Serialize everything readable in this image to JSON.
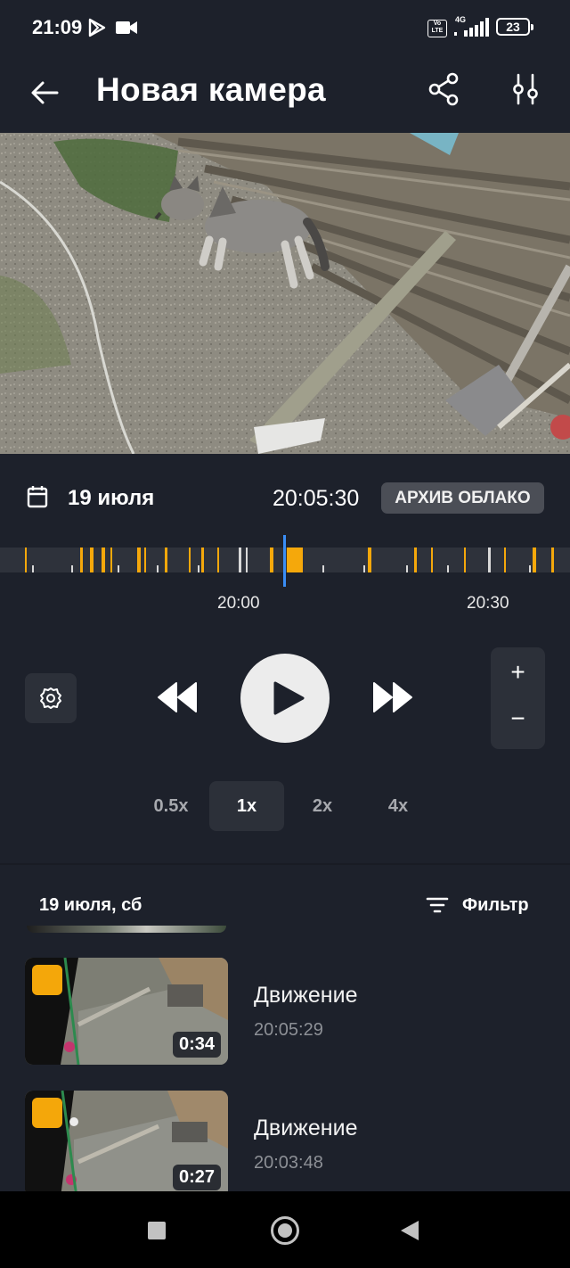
{
  "status_bar": {
    "time": "21:09",
    "volte_top": "Vo",
    "volte_bottom": "LTE",
    "network": "4G",
    "battery": "23",
    "icons": [
      "play-store-icon",
      "video-camera-icon",
      "volte-icon",
      "signal-icon",
      "battery-icon"
    ]
  },
  "app_bar": {
    "title": "Новая камера",
    "icons": [
      "back-arrow-icon",
      "share-icon",
      "tune-icon"
    ]
  },
  "player_info": {
    "date": "19 июля",
    "time": "20:05:30",
    "mode_badge": "АРХИВ ОБЛАКО",
    "icons": [
      "calendar-icon"
    ]
  },
  "timeline": {
    "labels": [
      "20:00",
      "20:30"
    ],
    "accent_color": "#f5a80b",
    "cursor_color": "#3a8ef6"
  },
  "controls": {
    "zoom_in": "+",
    "zoom_out": "−",
    "speeds": [
      "0.5x",
      "1x",
      "2x",
      "4x"
    ],
    "active_speed": "1x",
    "icons": [
      "settings-icon",
      "rewind-icon",
      "play-icon",
      "fast-forward-icon"
    ]
  },
  "events": {
    "day_header": "19 июля, сб",
    "filter_label": "Фильтр",
    "badge_color": "#f4a70a",
    "items": [
      {
        "title": "Движение",
        "time": "20:05:29",
        "duration": "0:34"
      },
      {
        "title": "Движение",
        "time": "20:03:48",
        "duration": "0:27"
      }
    ]
  },
  "nav_bar": {
    "icons": [
      "recents-icon",
      "home-icon",
      "back-icon"
    ]
  }
}
